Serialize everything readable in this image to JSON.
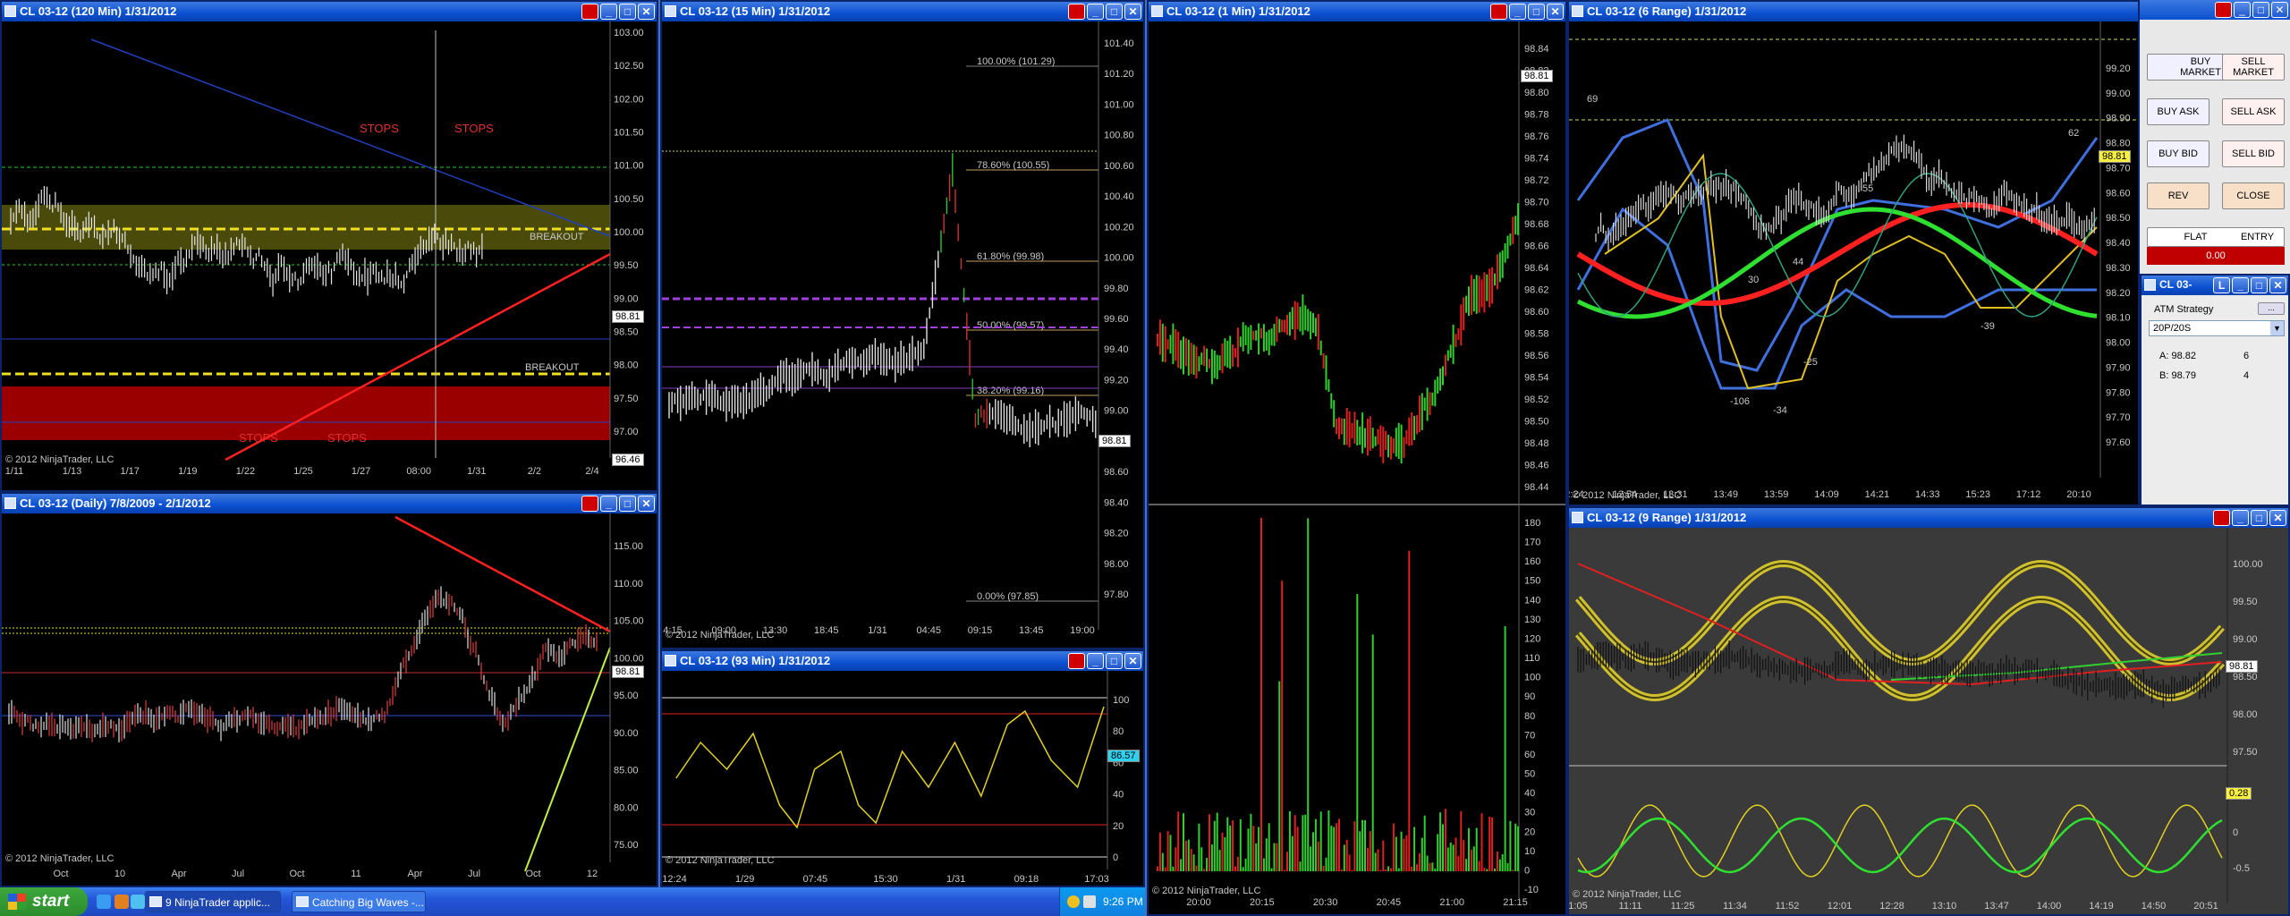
{
  "windows": {
    "w120": {
      "title": "CL 03-12 (120 Min)  1/31/2012",
      "price": "98.81",
      "last": "96.46",
      "copyright": "© 2012 NinjaTrader, LLC",
      "yticks": [
        "103.00",
        "102.50",
        "102.00",
        "101.50",
        "101.00",
        "100.50",
        "100.00",
        "99.50",
        "99.00",
        "98.50",
        "98.00",
        "97.50",
        "97.00"
      ],
      "xticks": [
        "1/11",
        "1/13",
        "1/17",
        "1/19",
        "1/22",
        "1/25",
        "1/27",
        "08:00",
        "1/31",
        "2/2",
        "2/4"
      ],
      "annotations": {
        "stops1": "STOPS",
        "stops2": "STOPS",
        "stops3": "STOPS",
        "stops4": "STOPS",
        "breakout1": "BREAKOUT",
        "breakout2": "BREAKOUT"
      }
    },
    "w15": {
      "title": "CL 03-12 (15 Min)  1/31/2012",
      "price": "98.81",
      "copyright": "© 2012 NinjaTrader, LLC",
      "yticks": [
        "101.40",
        "101.20",
        "101.00",
        "100.80",
        "100.60",
        "100.40",
        "100.20",
        "100.00",
        "99.80",
        "99.60",
        "99.40",
        "99.20",
        "99.00",
        "98.80",
        "98.60",
        "98.40",
        "98.20",
        "98.00",
        "97.80"
      ],
      "xticks": [
        "4:15",
        "09:00",
        "13:30",
        "18:45",
        "1/31",
        "04:45",
        "09:15",
        "13:45",
        "19:00"
      ],
      "fib": {
        "f100": "100.00% (101.29)",
        "f786": "78.60% (100.55)",
        "f618": "61.80% (99.98)",
        "f50": "50.00% (99.57)",
        "f382": "38.20% (99.16)",
        "f0": "0.00% (97.85)"
      }
    },
    "w1": {
      "title": "CL 03-12 (1 Min)  1/31/2012",
      "price": "98.81",
      "copyright": "© 2012 NinjaTrader, LLC",
      "yticks": [
        "98.84",
        "98.82",
        "98.80",
        "98.78",
        "98.76",
        "98.74",
        "98.72",
        "98.70",
        "98.68",
        "98.66",
        "98.64",
        "98.62",
        "98.60",
        "98.58",
        "98.56",
        "98.54",
        "98.52",
        "98.50",
        "98.48",
        "98.46",
        "98.44"
      ],
      "vticks": [
        "180",
        "170",
        "160",
        "150",
        "140",
        "130",
        "120",
        "110",
        "100",
        "90",
        "80",
        "70",
        "60",
        "50",
        "40",
        "30",
        "20",
        "10",
        "0",
        "-10"
      ],
      "xticks": [
        "20:00",
        "20:15",
        "20:30",
        "20:45",
        "21:00",
        "21:15"
      ]
    },
    "w6r": {
      "title": "CL 03-12 (6 Range)  1/31/2012",
      "price": "98.81",
      "copyright": "© 2012 NinjaTrader, LLC",
      "yticks": [
        "99.20",
        "99.00",
        "98.90",
        "98.80",
        "98.70",
        "98.60",
        "98.50",
        "98.40",
        "98.30",
        "98.20",
        "98.10",
        "98.00",
        "97.90",
        "97.80",
        "97.70",
        "97.60"
      ],
      "xticks": [
        "2:24",
        "12:54",
        "13:31",
        "13:49",
        "13:59",
        "14:09",
        "14:21",
        "14:33",
        "15:23",
        "17:12",
        "20:10"
      ],
      "labels": {
        "l69": "69",
        "l62": "62",
        "l55": "55",
        "l30": "30",
        "l44": "44",
        "lm25": "-25",
        "lm39": "-39",
        "lm106": "-106",
        "lm34": "-34"
      }
    },
    "wd": {
      "title": "CL 03-12 (Daily)  7/8/2009 - 2/1/2012",
      "price": "98.81",
      "copyright": "© 2012 NinjaTrader, LLC",
      "yticks": [
        "115.00",
        "110.00",
        "105.00",
        "100.00",
        "95.00",
        "90.00",
        "85.00",
        "80.00",
        "75.00"
      ],
      "xticks": [
        "Oct",
        "10",
        "Apr",
        "Jul",
        "Oct",
        "11",
        "Apr",
        "Jul",
        "Oct",
        "12"
      ]
    },
    "w93": {
      "title": "CL 03-12 (93 Min)  1/31/2012",
      "price": "86.57",
      "copyright": "© 2012 NinjaTrader, LLC",
      "yticks": [
        "100",
        "80",
        "60",
        "40",
        "20",
        "0"
      ],
      "xticks": [
        "12:24",
        "1/29",
        "07:45",
        "15:30",
        "1/31",
        "09:18",
        "17:03"
      ]
    },
    "w9r": {
      "title": "CL 03-12 (9 Range)  1/31/2012",
      "price": "98.81",
      "osc": "0.28",
      "copyright": "© 2012 NinjaTrader, LLC",
      "yticks": [
        "100.00",
        "99.50",
        "99.00",
        "98.50",
        "98.00",
        "97.50"
      ],
      "oticks": [
        "0.5",
        "0",
        "-0.5"
      ],
      "xticks": [
        "1:05",
        "11:11",
        "11:25",
        "11:34",
        "11:52",
        "12:01",
        "12:28",
        "13:10",
        "13:47",
        "14:00",
        "14:19",
        "14:50",
        "20:51"
      ]
    },
    "wctl": {
      "title": "CL 03-",
      "atm_label": "ATM Strategy",
      "atm_value": "20P/20S",
      "ask_label": "A: 98.82",
      "ask_qty": "6",
      "bid_label": "B: 98.79",
      "bid_qty": "4"
    }
  },
  "order_buttons": {
    "buy_market": "BUY MARKET",
    "sell_market": "SELL MARKET",
    "buy_ask": "BUY ASK",
    "sell_ask": "SELL ASK",
    "buy_bid": "BUY BID",
    "sell_bid": "SELL BID",
    "rev": "REV",
    "close": "CLOSE",
    "flat": "FLAT",
    "entry": "ENTRY",
    "pnl": "0.00"
  },
  "taskbar": {
    "start": "start",
    "task1": "9 NinjaTrader applic...",
    "task2": "Catching Big Waves -...",
    "clock": "9:26 PM"
  }
}
